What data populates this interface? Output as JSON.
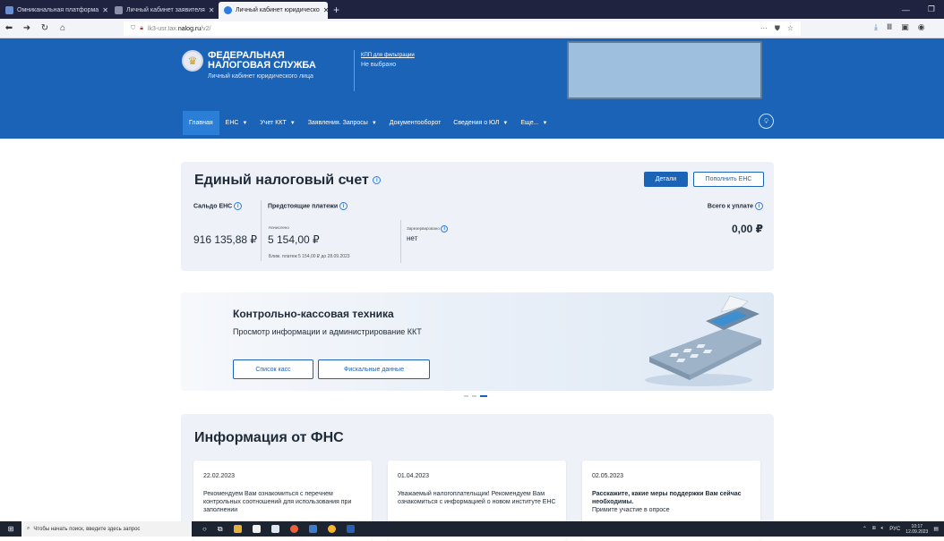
{
  "browser": {
    "tabs": [
      {
        "label": "Омниканальная платформа",
        "active": false,
        "color": "#6a8fd1"
      },
      {
        "label": "Личный кабинет заявителя",
        "active": false,
        "color": "#444a6a"
      },
      {
        "label": "Личный кабинет юридическо",
        "active": true,
        "color": "#2a7de1"
      }
    ],
    "url": "lk3-usr.tax.nalog.ru/v2/",
    "url_domain": "nalog.ru",
    "url_prefix": "lk3-usr.tax.",
    "url_suffix": "/v2/"
  },
  "header": {
    "brand_line1": "ФЕДЕРАЛЬНАЯ",
    "brand_line2": "НАЛОГОВАЯ СЛУЖБА",
    "brand_sub": "Личный кабинет юридического лица",
    "kpp_label": "КПП для фильтрации",
    "kpp_value": "Не выбрано"
  },
  "menu": [
    {
      "label": "Главная",
      "dropdown": false
    },
    {
      "label": "ЕНС",
      "dropdown": true
    },
    {
      "label": "Учет ККТ",
      "dropdown": true
    },
    {
      "label": "Заявления. Запросы",
      "dropdown": true
    },
    {
      "label": "Документооборот",
      "dropdown": false
    },
    {
      "label": "Сведения о ЮЛ",
      "dropdown": true
    },
    {
      "label": "Еще...",
      "dropdown": true
    }
  ],
  "ens": {
    "title": "Единый налоговый счет",
    "details_btn": "Детали",
    "topup_btn": "Пополнить ЕНС",
    "saldo_label": "Сальдо ЕНС",
    "saldo_value": "916 135,88 ₽",
    "upcoming_label": "Предстоящие платежи",
    "accrued_label": "Начислено",
    "accrued_value": "5 154,00 ₽",
    "reserved_label": "Зарезервировано",
    "reserved_value": "нет",
    "next_payment": "Ближ. платеж 5 154,00 ₽ до 28.09.2023",
    "total_label": "Всего к уплате",
    "total_value": "0,00 ₽"
  },
  "banner": {
    "title": "Контрольно-кассовая техника",
    "subtitle": "Просмотр информации и администрирование ККТ",
    "btn_list": "Список касс",
    "btn_fiscal": "Фискальные данные"
  },
  "info": {
    "title": "Информация от ФНС",
    "cards": [
      {
        "date": "22.02.2023",
        "text": "Рекомендуем Вам ознакомиться с перечнем контрольных соотношений для использования при заполнении",
        "bold": false
      },
      {
        "date": "01.04.2023",
        "text": "Уважаемый налогоплательщик! Рекомендуем Вам ознакомиться с информацией о новом институте ЕНС",
        "bold": false
      },
      {
        "date": "02.05.2023",
        "text": "Расскажите, какие меры поддержки Вам сейчас необходимы.",
        "text2": "Примите участие в опросе",
        "bold": true
      }
    ]
  },
  "taskbar": {
    "search_placeholder": "Чтобы начать поиск, введите здесь запрос",
    "lang": "РУС",
    "time": "10:17",
    "date": "12.09.2023"
  }
}
